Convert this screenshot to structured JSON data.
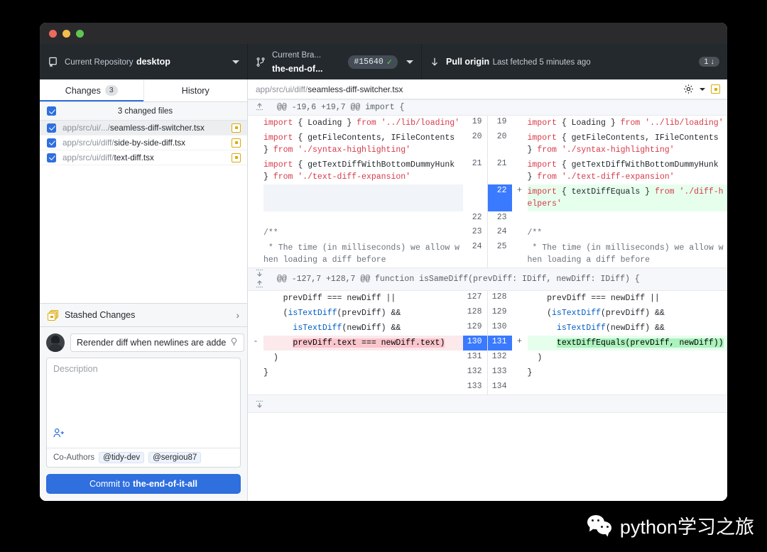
{
  "window": {
    "traffic_lights": [
      "close",
      "minimize",
      "maximize"
    ]
  },
  "toolbar": {
    "repository": {
      "label": "Current Repository",
      "value": "desktop",
      "icon": "repository-icon"
    },
    "branch": {
      "label": "Current Bra...",
      "value": "the-end-of...",
      "pr_number": "#15640",
      "pr_status_icon": "check-icon",
      "icon": "branch-icon"
    },
    "pull": {
      "label": "Pull origin",
      "sublabel": "Last fetched 5 minutes ago",
      "badge_count": "1",
      "badge_arrow": "↓",
      "icon": "arrow-down-icon"
    }
  },
  "sidebar": {
    "tabs": [
      {
        "label": "Changes",
        "count": "3",
        "active": true
      },
      {
        "label": "History",
        "count": "",
        "active": false
      }
    ],
    "files_header": "3 changed files",
    "files": [
      {
        "dir": "app/src/ui/.../",
        "name": "seamless-diff-switcher.tsx",
        "checked": true,
        "status": "modified",
        "selected": true
      },
      {
        "dir": "app/src/ui/diff/",
        "name": "side-by-side-diff.tsx",
        "checked": true,
        "status": "modified",
        "selected": false
      },
      {
        "dir": "app/src/ui/diff/",
        "name": "text-diff.tsx",
        "checked": true,
        "status": "modified",
        "selected": false
      }
    ],
    "stashed_changes": {
      "label": "Stashed Changes",
      "chevron": "›",
      "icon": "stash-icon"
    },
    "commit": {
      "summary_value": "Rerender diff when newlines are adde",
      "summary_hint_icon": "lightbulb-icon",
      "description_placeholder": "Description",
      "add_coauthor_icon": "person-plus-icon",
      "coauthors_label": "Co-Authors",
      "coauthors": [
        "@tidy-dev",
        "@sergiou87"
      ],
      "commit_button_prefix": "Commit to",
      "commit_button_branch": "the-end-of-it-all"
    }
  },
  "diff": {
    "filepath_dir": "app/src/ui/diff/",
    "filepath_name": "seamless-diff-switcher.tsx",
    "settings_icon": "gear-icon",
    "settings_caret_icon": "chevron-down-icon",
    "status_icon": "modified-square-icon",
    "hunks": [
      {
        "header": "@@ -19,6 +19,7 @@ import {",
        "expand_icon": "expand-up-icon",
        "rows": [
          {
            "left": {
              "no": "19",
              "marker": "",
              "tokens": [
                [
                  "kw",
                  "import"
                ],
                [
                  "pl",
                  " { "
                ],
                [
                  "pl",
                  "Loading"
                ],
                [
                  "pl",
                  " } "
                ],
                [
                  "kw",
                  "from"
                ],
                [
                  "pl",
                  " "
                ],
                [
                  "str",
                  "'../lib/loading'"
                ]
              ]
            },
            "right": {
              "no": "19",
              "marker": "",
              "tokens": [
                [
                  "kw",
                  "import"
                ],
                [
                  "pl",
                  " { "
                ],
                [
                  "pl",
                  "Loading"
                ],
                [
                  "pl",
                  " } "
                ],
                [
                  "kw",
                  "from"
                ],
                [
                  "pl",
                  " "
                ],
                [
                  "str",
                  "'../lib/loading'"
                ]
              ]
            },
            "type": "context"
          },
          {
            "left": {
              "no": "20",
              "marker": "",
              "tokens": [
                [
                  "kw",
                  "import"
                ],
                [
                  "pl",
                  " { getFileContents, IFileContents } "
                ],
                [
                  "kw",
                  "from"
                ],
                [
                  "pl",
                  " "
                ],
                [
                  "str",
                  "'./syntax-highlighting'"
                ]
              ]
            },
            "right": {
              "no": "20",
              "marker": "",
              "tokens": [
                [
                  "kw",
                  "import"
                ],
                [
                  "pl",
                  " { getFileContents, IFileContents } "
                ],
                [
                  "kw",
                  "from"
                ],
                [
                  "pl",
                  " "
                ],
                [
                  "str",
                  "'./syntax-highlighting'"
                ]
              ]
            },
            "type": "context"
          },
          {
            "left": {
              "no": "21",
              "marker": "",
              "tokens": [
                [
                  "kw",
                  "import"
                ],
                [
                  "pl",
                  " { getTextDiffWithBottomDummyHunk } "
                ],
                [
                  "kw",
                  "from"
                ],
                [
                  "pl",
                  " "
                ],
                [
                  "str",
                  "'./text-diff-expansion'"
                ]
              ]
            },
            "right": {
              "no": "21",
              "marker": "",
              "tokens": [
                [
                  "kw",
                  "import"
                ],
                [
                  "pl",
                  " { getTextDiffWithBottomDummyHunk } "
                ],
                [
                  "kw",
                  "from"
                ],
                [
                  "pl",
                  " "
                ],
                [
                  "str",
                  "'./text-diff-expansion'"
                ]
              ]
            },
            "type": "context"
          },
          {
            "left": {
              "no": "",
              "marker": "",
              "tokens": []
            },
            "right": {
              "no": "22",
              "marker": "+",
              "tokens": [
                [
                  "kw",
                  "import"
                ],
                [
                  "pl",
                  " { textDiffEquals } "
                ],
                [
                  "kw",
                  "from"
                ],
                [
                  "pl",
                  " "
                ],
                [
                  "str",
                  "'./diff-helpers'"
                ]
              ],
              "selected": true
            },
            "type": "add"
          },
          {
            "left": {
              "no": "22",
              "marker": "",
              "tokens": []
            },
            "right": {
              "no": "23",
              "marker": "",
              "tokens": []
            },
            "type": "context"
          },
          {
            "left": {
              "no": "23",
              "marker": "",
              "tokens": [
                [
                  "cm",
                  "/**"
                ]
              ]
            },
            "right": {
              "no": "24",
              "marker": "",
              "tokens": [
                [
                  "cm",
                  "/**"
                ]
              ]
            },
            "type": "context"
          },
          {
            "left": {
              "no": "24",
              "marker": "",
              "tokens": [
                [
                  "cm",
                  " * The time (in milliseconds) we allow when loading a diff before"
                ]
              ]
            },
            "right": {
              "no": "25",
              "marker": "",
              "tokens": [
                [
                  "cm",
                  " * The time (in milliseconds) we allow when loading a diff before"
                ]
              ]
            },
            "type": "context"
          }
        ]
      },
      {
        "header": "@@ -127,7 +128,7 @@ function isSameDiff(prevDiff: IDiff, newDiff: IDiff) {",
        "expand_icon": "expand-both-icon",
        "rows": [
          {
            "left": {
              "no": "127",
              "marker": "",
              "tokens": [
                [
                  "pl",
                  "    prevDiff === newDiff ||"
                ]
              ]
            },
            "right": {
              "no": "128",
              "marker": "",
              "tokens": [
                [
                  "pl",
                  "    prevDiff === newDiff ||"
                ]
              ]
            },
            "type": "context"
          },
          {
            "left": {
              "no": "128",
              "marker": "",
              "tokens": [
                [
                  "pl",
                  "    ("
                ],
                [
                  "id",
                  "isTextDiff"
                ],
                [
                  "pl",
                  "(prevDiff) &&"
                ]
              ]
            },
            "right": {
              "no": "129",
              "marker": "",
              "tokens": [
                [
                  "pl",
                  "    ("
                ],
                [
                  "id",
                  "isTextDiff"
                ],
                [
                  "pl",
                  "(prevDiff) &&"
                ]
              ]
            },
            "type": "context"
          },
          {
            "left": {
              "no": "129",
              "marker": "",
              "tokens": [
                [
                  "pl",
                  "      "
                ],
                [
                  "id",
                  "isTextDiff"
                ],
                [
                  "pl",
                  "(newDiff) &&"
                ]
              ]
            },
            "right": {
              "no": "130",
              "marker": "",
              "tokens": [
                [
                  "pl",
                  "      "
                ],
                [
                  "id",
                  "isTextDiff"
                ],
                [
                  "pl",
                  "(newDiff) &&"
                ]
              ]
            },
            "type": "context"
          },
          {
            "left": {
              "no": "130",
              "marker": "-",
              "tokens": [
                [
                  "pl",
                  "      "
                ],
                [
                  "wd-del",
                  "prevDiff.text === newDiff.text)"
                ]
              ],
              "selected": true
            },
            "right": {
              "no": "131",
              "marker": "+",
              "tokens": [
                [
                  "pl",
                  "      "
                ],
                [
                  "wd-add",
                  "textDiffEquals(prevDiff, newDiff))"
                ]
              ],
              "selected": true
            },
            "type": "change"
          },
          {
            "left": {
              "no": "131",
              "marker": "",
              "tokens": [
                [
                  "pl",
                  "  )"
                ]
              ]
            },
            "right": {
              "no": "132",
              "marker": "",
              "tokens": [
                [
                  "pl",
                  "  )"
                ]
              ]
            },
            "type": "context"
          },
          {
            "left": {
              "no": "132",
              "marker": "",
              "tokens": [
                [
                  "pl",
                  "}"
                ]
              ]
            },
            "right": {
              "no": "133",
              "marker": "",
              "tokens": [
                [
                  "pl",
                  "}"
                ]
              ]
            },
            "type": "context"
          },
          {
            "left": {
              "no": "133",
              "marker": "",
              "tokens": []
            },
            "right": {
              "no": "134",
              "marker": "",
              "tokens": []
            },
            "type": "context"
          }
        ]
      }
    ],
    "bottom_expand_icon": "expand-down-icon"
  },
  "watermark": {
    "text": "python学习之旅",
    "icon": "wechat-icon"
  },
  "colors": {
    "accent_blue": "#2f6fde",
    "toolbar_dark": "#24292e",
    "titlebar_dark": "#2b2b2d",
    "add_bg": "#e6ffed",
    "del_bg": "#fbe9eb",
    "add_word": "#acf2bd",
    "del_word": "#fac5cd",
    "modified_amber": "#dbab09",
    "selected_line": "#3a7afe"
  }
}
